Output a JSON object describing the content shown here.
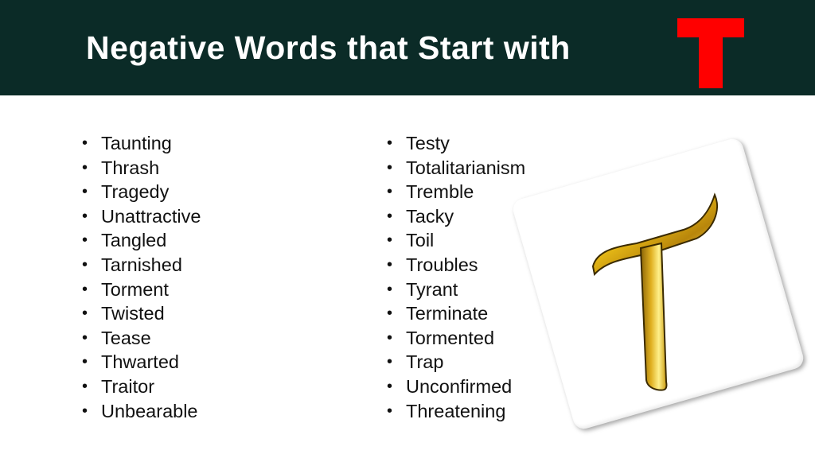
{
  "header": {
    "title": "Negative Words that Start with",
    "letter": "T",
    "background_color": "#0b2b27",
    "letter_color": "#ff0000"
  },
  "lists": {
    "column1": [
      "Taunting",
      "Thrash",
      "Tragedy",
      "Unattractive",
      "Tangled",
      "Tarnished",
      "Torment",
      "Twisted",
      "Tease",
      "Thwarted",
      "Traitor",
      "Unbearable"
    ],
    "column2": [
      "Testy",
      "Totalitarianism",
      "Tremble",
      "Tacky",
      "Toil",
      "Troubles",
      "Tyrant",
      "Terminate",
      "Tormented",
      "Trap",
      "Unconfirmed",
      "Threatening"
    ]
  },
  "illustration": {
    "icon": "gold-letter-t-tile",
    "letter": "T",
    "accent_color": "#e6b800"
  }
}
